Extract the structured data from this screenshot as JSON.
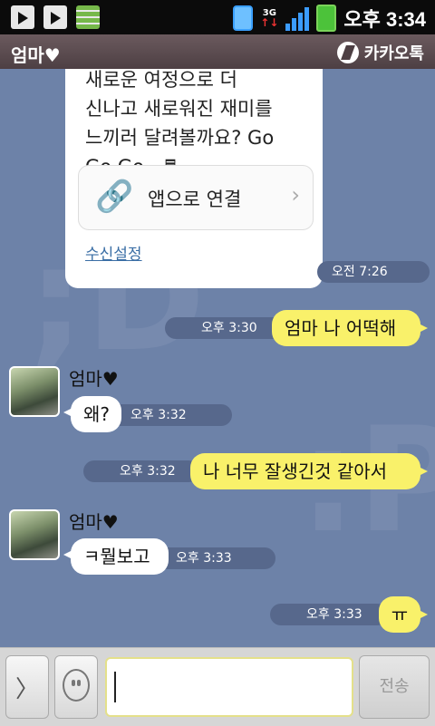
{
  "status_bar": {
    "network_type": "3G",
    "clock": "오후 3:34",
    "icons": [
      "play-store-icon",
      "play-store-icon",
      "storage-icon",
      "vibrate-icon",
      "data-transfer-icon",
      "signal-icon",
      "battery-icon"
    ]
  },
  "header": {
    "title": "엄마♥",
    "app_name": "카카오톡"
  },
  "link_card": {
    "text": "새로운 여정으로 더\n신나고 새로워진 재미를\n느끼러 달려볼까요? Go\nGo Go~♬",
    "link_label": "앱으로 연결",
    "settings_link": "수신설정",
    "time": "오전 7:26"
  },
  "messages": [
    {
      "side": "me",
      "text": "엄마 나 어떡해",
      "time": "오후 3:30"
    },
    {
      "side": "them",
      "sender": "엄마♥",
      "text": "왜?",
      "time": "오후 3:32"
    },
    {
      "side": "me",
      "text": "나 너무 잘생긴것 같아서",
      "time": "오후 3:32"
    },
    {
      "side": "them",
      "sender": "엄마♥",
      "text": "ㅋ뭘보고",
      "time": "오후 3:33"
    },
    {
      "side": "me",
      "text": "ㅠ",
      "time": "오후 3:33"
    }
  ],
  "input_bar": {
    "placeholder": "",
    "send_label": "전송"
  },
  "colors": {
    "chat_bg": "#6d82a8",
    "my_bubble": "#f9f16a",
    "their_bubble": "#ffffff",
    "header_bg": "#4d3f43"
  }
}
